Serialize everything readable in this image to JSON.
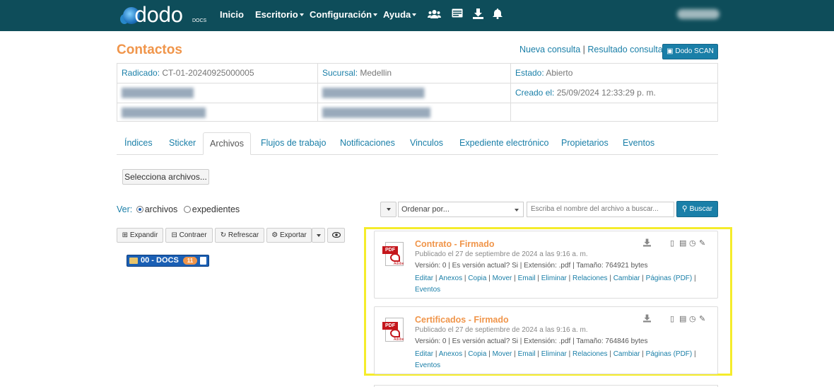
{
  "nav": {
    "logo_text": "dodo",
    "logo_sub": "DOCS",
    "items": [
      "Inicio",
      "Escritorio",
      "Configuración",
      "Ayuda"
    ],
    "icons": [
      "users-icon",
      "card-icon",
      "download-icon",
      "bell-icon"
    ]
  },
  "header": {
    "title": "Contactos",
    "link_new": "Nueva consulta",
    "link_sep": "|",
    "link_result": "Resultado consulta",
    "scan_button": "Dodo SCAN"
  },
  "info": {
    "radicado_label": "Radicado:",
    "radicado_value": "CT-01-20240925000005",
    "sucursal_label": "Sucursal:",
    "sucursal_value": "Medellin",
    "estado_label": "Estado:",
    "estado_value": "Abierto",
    "creado_label": "Creado el:",
    "creado_value": "25/09/2024 12:33:29 p. m."
  },
  "tabs": [
    "Índices",
    "Sticker",
    "Archivos",
    "Flujos de trabajo",
    "Notificaciones",
    "Vinculos",
    "Expediente electrónico",
    "Propietarios",
    "Eventos"
  ],
  "files_toolbar": {
    "select_files": "Selecciona archivos...",
    "ver_label": "Ver:",
    "opt_archivos": "archivos",
    "opt_expedientes": "expedientes",
    "order_placeholder": "Ordenar por...",
    "search_placeholder": "Escriba el nombre del archivo a buscar...",
    "search_button": "Buscar"
  },
  "tree_toolbar": {
    "expand": "Expandir",
    "collapse": "Contraer",
    "refresh": "Refrescar",
    "export": "Exportar"
  },
  "folder": {
    "name": "00 - DOCS",
    "count": "11"
  },
  "files": [
    {
      "title": "Contrato - Firmado",
      "published": "Publicado el 27 de septiembre de 2024 a las 9:16 a. m.",
      "meta": "Versión: 0 | Es versión actual? Si | Extensión: .pdf | Tamaño: 764921 bytes",
      "actions": [
        "Editar",
        "Anexos",
        "Copia",
        "Mover",
        "Email",
        "Eliminar",
        "Relaciones",
        "Cambiar",
        "Páginas (PDF)",
        "Eventos"
      ]
    },
    {
      "title": "Certificados - Firmado",
      "published": "Publicado el 27 de septiembre de 2024 a las 9:16 a. m.",
      "meta": "Versión: 0 | Es versión actual? Si | Extensión: .pdf | Tamaño: 764846 bytes",
      "actions": [
        "Editar",
        "Anexos",
        "Copia",
        "Mover",
        "Email",
        "Eliminar",
        "Relaciones",
        "Cambiar",
        "Páginas (PDF)",
        "Eventos"
      ]
    }
  ],
  "colors": {
    "navbar": "#0e4d5a",
    "accent": "#1a7fa8",
    "title": "#f0954a",
    "highlight": "#f5ec2b"
  }
}
